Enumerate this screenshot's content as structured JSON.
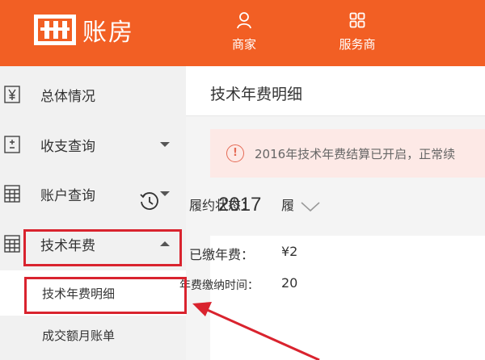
{
  "app": {
    "logo_text": "账房",
    "brand_color": "#f25f24"
  },
  "topnav": [
    {
      "label": "商家",
      "icon": "user-icon"
    },
    {
      "label": "服务商",
      "icon": "grid-icon"
    }
  ],
  "sidebar": {
    "items": [
      {
        "label": "总体情况",
        "icon": "yen-icon"
      },
      {
        "label": "收支查询",
        "icon": "ledger-icon",
        "caret": "down"
      },
      {
        "label": "账户查询",
        "icon": "table-icon",
        "caret": "down"
      },
      {
        "label": "技术年费",
        "icon": "table-icon",
        "caret": "up"
      }
    ],
    "subitems": [
      {
        "label": "技术年费明细",
        "active": true
      },
      {
        "label": "成交额月账单",
        "active": false
      }
    ]
  },
  "main": {
    "title": "技术年费明细",
    "notice": "2016年技术年费结算已开启，正常续",
    "year": "2017",
    "fields": {
      "status_label": "履约状态：",
      "status_value": "履",
      "paid_label": "已缴年费：",
      "paid_value": "¥2",
      "time_label": "年费缴纳时间：",
      "time_value": "20"
    }
  },
  "annotation_color": "#d9232e"
}
